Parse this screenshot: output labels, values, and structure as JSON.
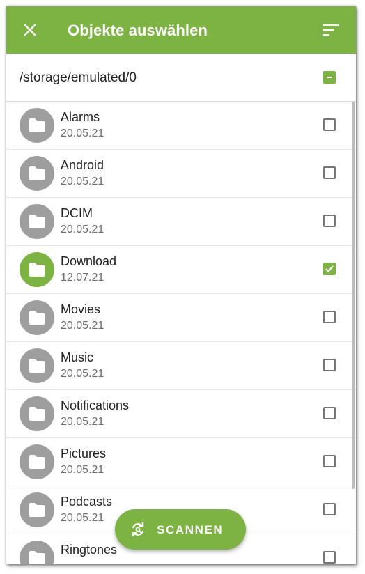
{
  "appbar": {
    "title": "Objekte auswählen",
    "close_icon": "close-icon",
    "sort_icon": "sort-icon",
    "color": "#7cb342"
  },
  "path": {
    "label": "/storage/emulated/0",
    "checkbox_state": "partial"
  },
  "items": [
    {
      "name": "Alarms",
      "date": "20.05.21",
      "checked": false
    },
    {
      "name": "Android",
      "date": "20.05.21",
      "checked": false
    },
    {
      "name": "DCIM",
      "date": "20.05.21",
      "checked": false
    },
    {
      "name": "Download",
      "date": "12.07.21",
      "checked": true
    },
    {
      "name": "Movies",
      "date": "20.05.21",
      "checked": false
    },
    {
      "name": "Music",
      "date": "20.05.21",
      "checked": false
    },
    {
      "name": "Notifications",
      "date": "20.05.21",
      "checked": false
    },
    {
      "name": "Pictures",
      "date": "20.05.21",
      "checked": false
    },
    {
      "name": "Podcasts",
      "date": "20.05.21",
      "checked": false
    },
    {
      "name": "Ringtones",
      "date": "",
      "checked": false
    }
  ],
  "fab": {
    "label": "SCANNEN",
    "icon": "scan-refresh-icon"
  },
  "colors": {
    "accent": "#7cb342",
    "folder_default": "#9e9e9e"
  }
}
